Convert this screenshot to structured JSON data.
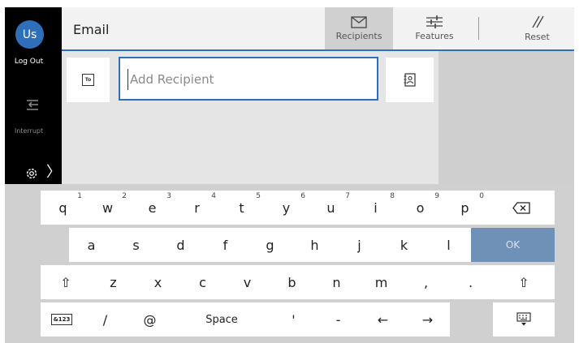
{
  "user": {
    "initials": "Us",
    "logout_label": "Log Out"
  },
  "sidebar": {
    "interrupt_label": "Interrupt",
    "settings_icon": "gear-icon",
    "expand_icon": "chevron-right-icon"
  },
  "header": {
    "title": "Email",
    "tabs": [
      {
        "label": "Recipients",
        "icon": "envelope-icon",
        "selected": true
      },
      {
        "label": "Features",
        "icon": "sliders-icon",
        "selected": false
      },
      {
        "label": "Reset",
        "icon": "reset-icon",
        "selected": false
      }
    ]
  },
  "recipient": {
    "to_label": "To",
    "placeholder": "Add Recipient",
    "value": "",
    "address_book_icon": "address-book-icon"
  },
  "keyboard": {
    "row1": [
      {
        "label": "q",
        "sup": "1"
      },
      {
        "label": "w",
        "sup": "2"
      },
      {
        "label": "e",
        "sup": "3"
      },
      {
        "label": "r",
        "sup": "4"
      },
      {
        "label": "t",
        "sup": "5"
      },
      {
        "label": "y",
        "sup": "6"
      },
      {
        "label": "u",
        "sup": "7"
      },
      {
        "label": "i",
        "sup": "8"
      },
      {
        "label": "o",
        "sup": "9"
      },
      {
        "label": "p",
        "sup": "0"
      }
    ],
    "row2": [
      "a",
      "s",
      "d",
      "f",
      "g",
      "h",
      "j",
      "k",
      "l"
    ],
    "row3": [
      "z",
      "x",
      "c",
      "v",
      "b",
      "n",
      "m",
      ",",
      "."
    ],
    "row4": {
      "mode_label": "&123",
      "slash": "/",
      "at": "@",
      "space": "Space",
      "apostrophe": "'",
      "dash": "-",
      "left": "←",
      "right": "→"
    },
    "ok_label": "OK",
    "shift_symbol": "⇧",
    "backspace_icon": "backspace-icon",
    "hide_keyboard_icon": "keyboard-hide-icon"
  },
  "colors": {
    "accent": "#2f6fba",
    "ok_key": "#6f91b8",
    "sidebar_bg": "#000000"
  }
}
